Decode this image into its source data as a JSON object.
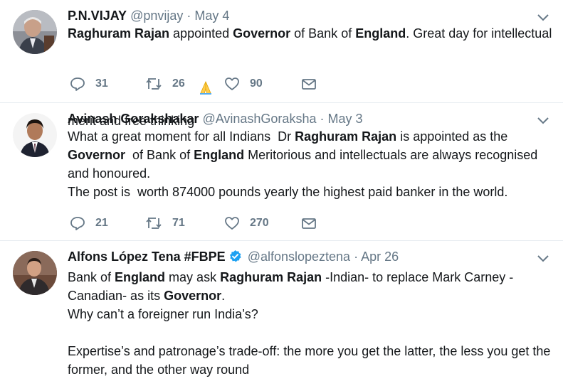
{
  "tweets": [
    {
      "name": "P.N.VIJAY",
      "handle": "@pnvijay",
      "separator": "·",
      "date": "May 4",
      "lines": [
        [
          {
            "t": "Raghuram Rajan",
            "b": true
          },
          {
            "t": " appointed ",
            "b": false
          },
          {
            "t": "Governor",
            "b": true
          },
          {
            "t": " of Bank of ",
            "b": false
          },
          {
            "t": "England",
            "b": true
          },
          {
            "t": ". Great day for intellectual merit and free thinking ",
            "b": false
          }
        ]
      ],
      "emoji": "folded-hands-emoji",
      "replies": "31",
      "retweets": "26",
      "likes": "90"
    },
    {
      "name": "Avinash Gorakshakar",
      "handle": "@AvinashGoraksha",
      "separator": "·",
      "date": "May 3",
      "lines": [
        [
          {
            "t": "What a great moment for all Indians  Dr ",
            "b": false
          },
          {
            "t": "Raghuram Rajan",
            "b": true
          },
          {
            "t": " is appointed as the ",
            "b": false
          },
          {
            "t": "Governor",
            "b": true
          },
          {
            "t": "  of Bank of ",
            "b": false
          },
          {
            "t": "England",
            "b": true
          },
          {
            "t": " Meritorious and intellectuals are always recognised and honoured.",
            "b": false
          }
        ],
        [
          {
            "t": "The post is  worth 874000 pounds yearly the highest paid banker in the world.",
            "b": false
          }
        ]
      ],
      "replies": "21",
      "retweets": "71",
      "likes": "270"
    },
    {
      "name": "Alfons López Tena #FBPE",
      "handle": "@alfonslopeztena",
      "separator": "·",
      "date": "Apr 26",
      "verified": true,
      "lines": [
        [
          {
            "t": "Bank of ",
            "b": false
          },
          {
            "t": "England",
            "b": true
          },
          {
            "t": " may ask ",
            "b": false
          },
          {
            "t": "Raghuram Rajan",
            "b": true
          },
          {
            "t": " -Indian- to replace Mark Carney - Canadian- as its ",
            "b": false
          },
          {
            "t": "Governor",
            "b": true
          },
          {
            "t": ".",
            "b": false
          }
        ],
        [
          {
            "t": "Why can’t a foreigner run India’s?",
            "b": false
          }
        ],
        [
          {
            "t": "",
            "b": false
          }
        ],
        [
          {
            "t": "Expertise’s and patronage’s trade-off: the more you get the latter, the less you get the former, and the other way round",
            "b": false
          }
        ]
      ]
    }
  ],
  "colors": {
    "text": "#14171a",
    "muted": "#657786",
    "divider": "#e6ecf0",
    "verified": "#1da1f2"
  }
}
